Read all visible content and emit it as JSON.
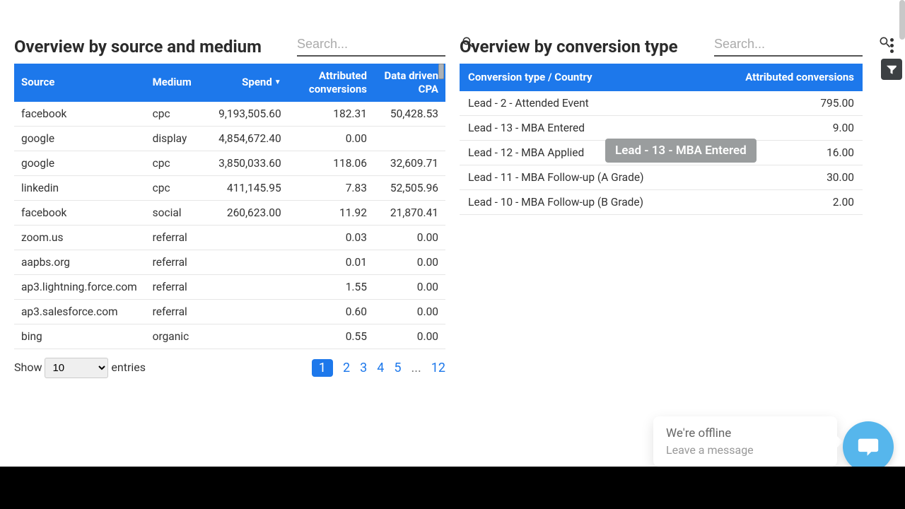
{
  "left": {
    "title": "Overview by source and medium",
    "search_placeholder": "Search...",
    "columns": {
      "source": "Source",
      "medium": "Medium",
      "spend": "Spend",
      "attr": "Attributed conversions",
      "cpa": "Data driven CPA"
    },
    "rows": [
      {
        "source": "facebook",
        "medium": "cpc",
        "spend": "9,193,505.60",
        "attr": "182.31",
        "cpa": "50,428.53"
      },
      {
        "source": "google",
        "medium": "display",
        "spend": "4,854,672.40",
        "attr": "0.00",
        "cpa": ""
      },
      {
        "source": "google",
        "medium": "cpc",
        "spend": "3,850,033.60",
        "attr": "118.06",
        "cpa": "32,609.71"
      },
      {
        "source": "linkedin",
        "medium": "cpc",
        "spend": "411,145.95",
        "attr": "7.83",
        "cpa": "52,505.96"
      },
      {
        "source": "facebook",
        "medium": "social",
        "spend": "260,623.00",
        "attr": "11.92",
        "cpa": "21,870.41"
      },
      {
        "source": "zoom.us",
        "medium": "referral",
        "spend": "",
        "attr": "0.03",
        "cpa": "0.00"
      },
      {
        "source": "aapbs.org",
        "medium": "referral",
        "spend": "",
        "attr": "0.01",
        "cpa": "0.00"
      },
      {
        "source": "ap3.lightning.force.com",
        "medium": "referral",
        "spend": "",
        "attr": "1.55",
        "cpa": "0.00"
      },
      {
        "source": "ap3.salesforce.com",
        "medium": "referral",
        "spend": "",
        "attr": "0.60",
        "cpa": "0.00"
      },
      {
        "source": "bing",
        "medium": "organic",
        "spend": "",
        "attr": "0.55",
        "cpa": "0.00"
      }
    ],
    "pager": {
      "show_label_pre": "Show",
      "show_label_post": "entries",
      "show_value": "10",
      "pages": [
        "1",
        "2",
        "3",
        "4",
        "5",
        "...",
        "12"
      ],
      "active_index": 0
    }
  },
  "right": {
    "title": "Overview by conversion type",
    "search_placeholder": "Search...",
    "columns": {
      "type": "Conversion type / Country",
      "attr": "Attributed conversions"
    },
    "rows": [
      {
        "type": "Lead - 2 - Attended Event",
        "attr": "795.00"
      },
      {
        "type": "Lead - 13 - MBA Entered",
        "attr": "9.00"
      },
      {
        "type": "Lead - 12 - MBA Applied",
        "attr": "16.00"
      },
      {
        "type": "Lead - 11 - MBA Follow-up (A Grade)",
        "attr": "30.00"
      },
      {
        "type": "Lead - 10 - MBA Follow-up (B Grade)",
        "attr": "2.00"
      }
    ]
  },
  "tooltip": "Lead - 13 - MBA Entered",
  "chat": {
    "line1": "We're offline",
    "line2": "Leave a message"
  }
}
